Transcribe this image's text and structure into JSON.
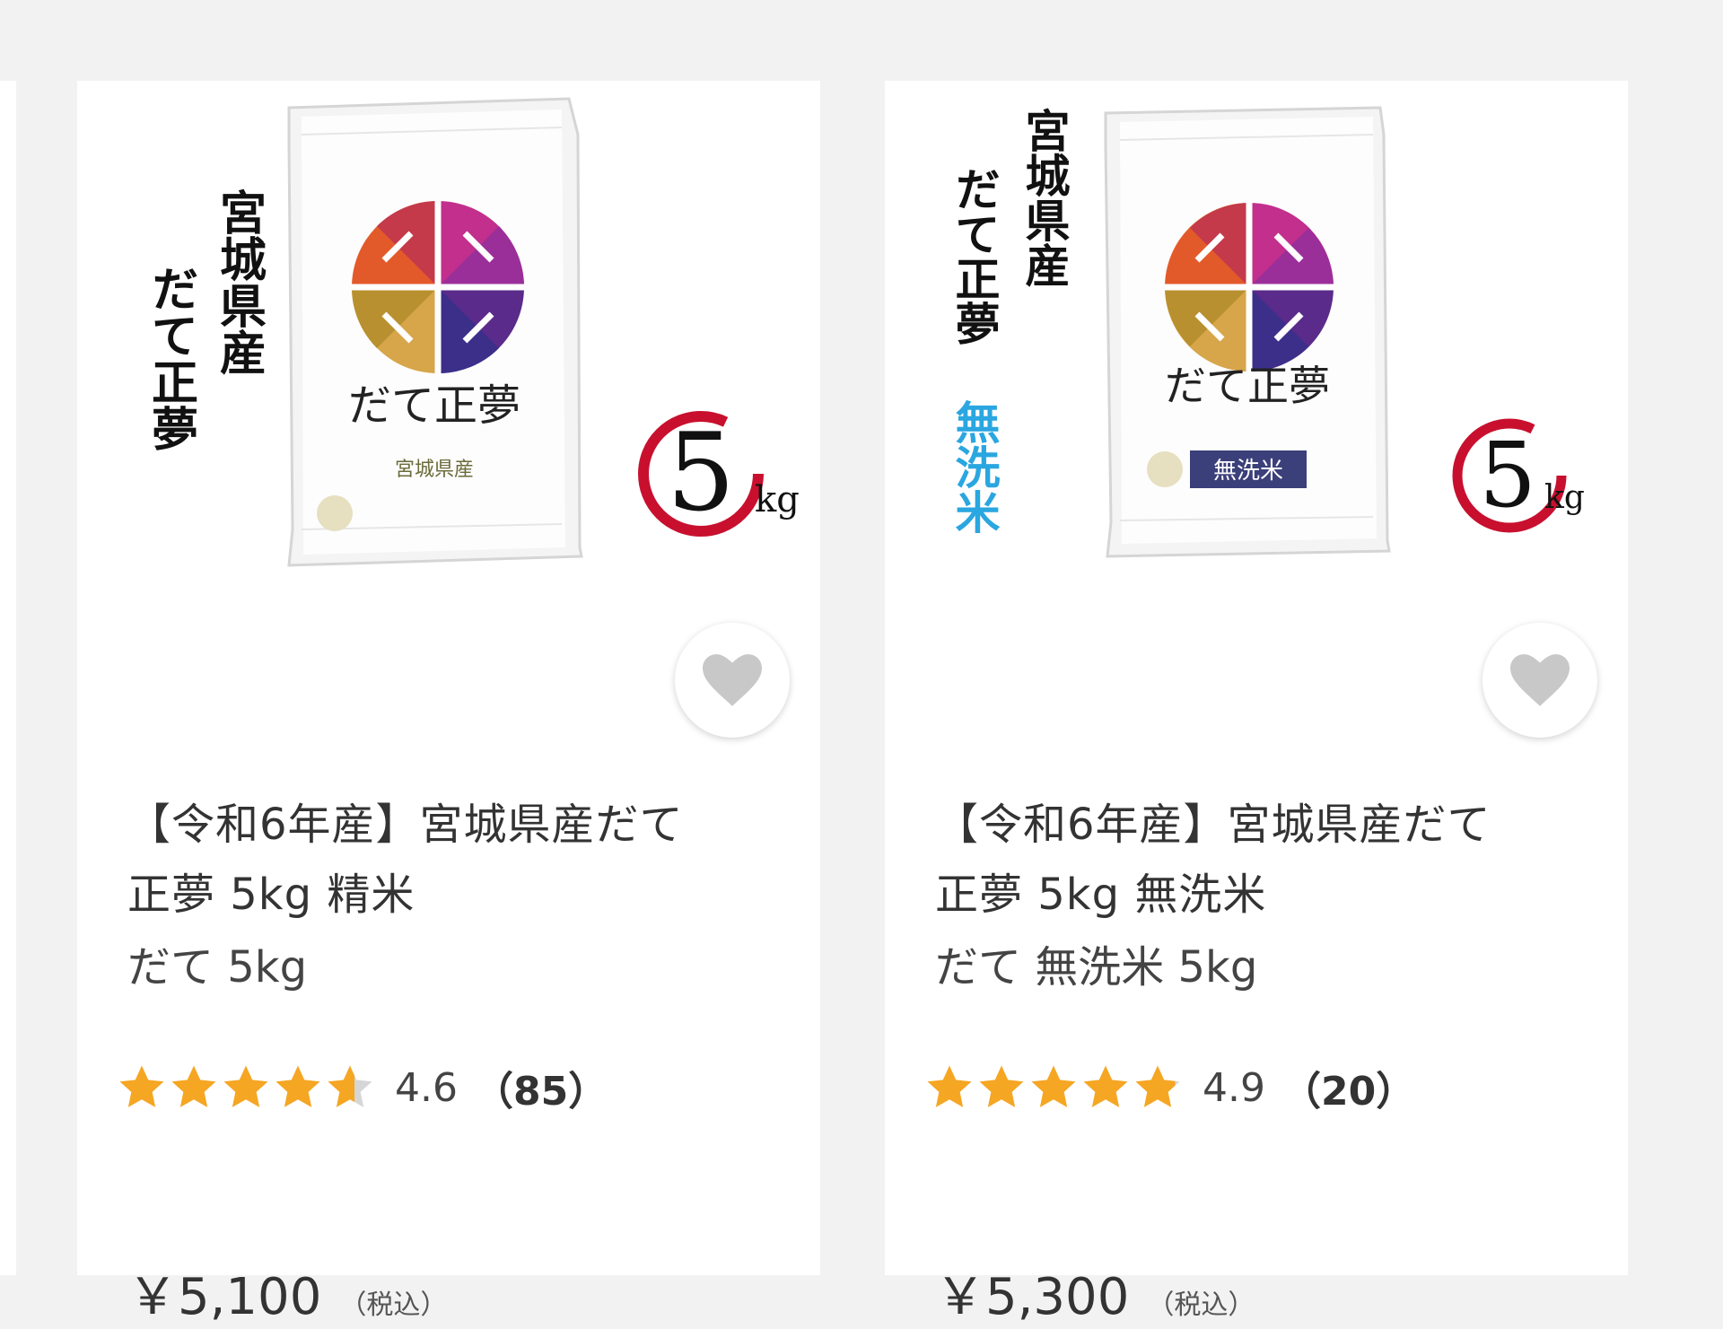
{
  "products": [
    {
      "title_line1": "【令和6年産】宮城県産だて",
      "title_line2": "正夢 5kg 精米",
      "subtitle": "だて 5kg",
      "rating_value": "4.6",
      "rating_stars": 4.6,
      "review_count": "（85）",
      "price": "￥5,100",
      "tax_note": "（税込）",
      "image": {
        "vertical_text": [
          "宮城県産",
          "だて正夢"
        ],
        "bag_logo": "だて正夢",
        "bag_label": "宮城県産",
        "weight_num": "5",
        "weight_unit": "kg"
      }
    },
    {
      "title_line1": "【令和6年産】宮城県産だて",
      "title_line2": "正夢 5kg 無洗米",
      "subtitle": "だて 無洗米 5kg",
      "rating_value": "4.9",
      "rating_stars": 4.9,
      "review_count": "（20）",
      "price": "￥5,300",
      "tax_note": "（税込）",
      "image": {
        "vertical_text": [
          "宮城県産",
          "だて正夢",
          "無洗米"
        ],
        "bag_logo": "だて正夢",
        "bag_label": "無洗米",
        "weight_num": "5",
        "weight_unit": "kg"
      }
    }
  ],
  "colors": {
    "star": "#f5a623",
    "star_empty": "#d6d6d6",
    "heart": "#c8c8c8",
    "card_bg": "#ffffff",
    "page_bg": "#f2f2f2",
    "musenmai_blue": "#2aa6e0",
    "stamp_red": "#c8102e"
  }
}
